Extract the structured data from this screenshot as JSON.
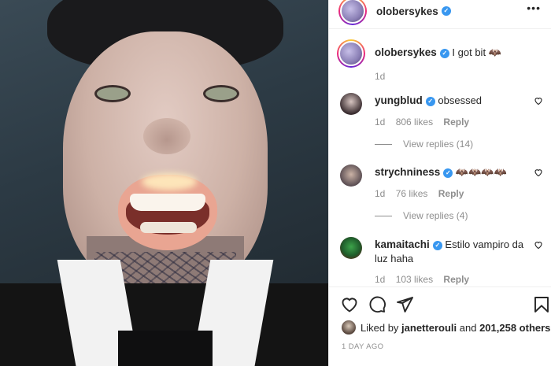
{
  "post": {
    "author": "olobersykes",
    "caption": "I got bit 🦇",
    "caption_age": "1d"
  },
  "comments": [
    {
      "username": "yungblud",
      "text": "obsessed",
      "age": "1d",
      "likes": "806 likes",
      "reply_label": "Reply",
      "view_replies": "View replies (14)"
    },
    {
      "username": "strychniness",
      "text": "🦇🦇🦇🦇",
      "age": "1d",
      "likes": "76 likes",
      "reply_label": "Reply",
      "view_replies": "View replies (4)"
    },
    {
      "username": "kamaitachi",
      "text": "Estilo vampiro da luz haha",
      "age": "1d",
      "likes": "103 likes",
      "reply_label": "Reply"
    }
  ],
  "likes_line": {
    "prefix": "Liked by",
    "user": "janetterouli",
    "joiner": "and",
    "others": "201,258 others"
  },
  "timestamp": "1 DAY AGO",
  "icons": {
    "like": "heart-icon",
    "comment": "comment-icon",
    "share": "paper-plane-icon",
    "save": "bookmark-icon",
    "more": "more-options-icon",
    "verified": "verified-badge-icon"
  },
  "colors": {
    "verified": "#3897f0",
    "text": "#262626",
    "muted": "#8e8e8e"
  }
}
